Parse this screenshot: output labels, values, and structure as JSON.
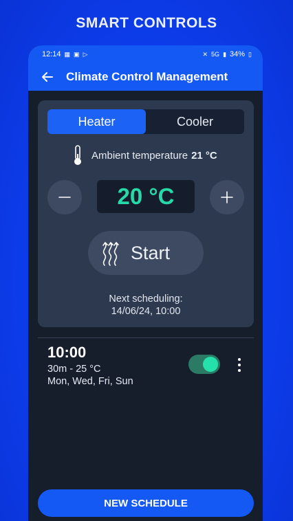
{
  "promo": {
    "title": "SMART CONTROLS"
  },
  "status_bar": {
    "time": "12:14",
    "battery": "34%",
    "network": "5G"
  },
  "app_bar": {
    "title": "Climate Control Management",
    "back_icon": "arrow-left-icon"
  },
  "mode": {
    "options": [
      "Heater",
      "Cooler"
    ],
    "selected": "Heater"
  },
  "ambient": {
    "label": "Ambient temperature",
    "value": "21 °C",
    "icon": "thermometer-icon"
  },
  "target": {
    "value": "20 °C",
    "decrease_icon": "minus-icon",
    "increase_icon": "plus-icon"
  },
  "start": {
    "label": "Start",
    "icon": "heat-waves-icon"
  },
  "next_scheduling": {
    "label": "Next scheduling:",
    "value": "14/06/24, 10:00"
  },
  "schedules": [
    {
      "time": "10:00",
      "detail": "30m - 25 °C",
      "days": "Mon, Wed, Fri, Sun",
      "enabled": true
    }
  ],
  "new_schedule": {
    "label": "NEW SCHEDULE"
  },
  "colors": {
    "accent": "#1559f5",
    "teal": "#27d9a8",
    "card": "#2d394f",
    "background": "#161d2b"
  }
}
